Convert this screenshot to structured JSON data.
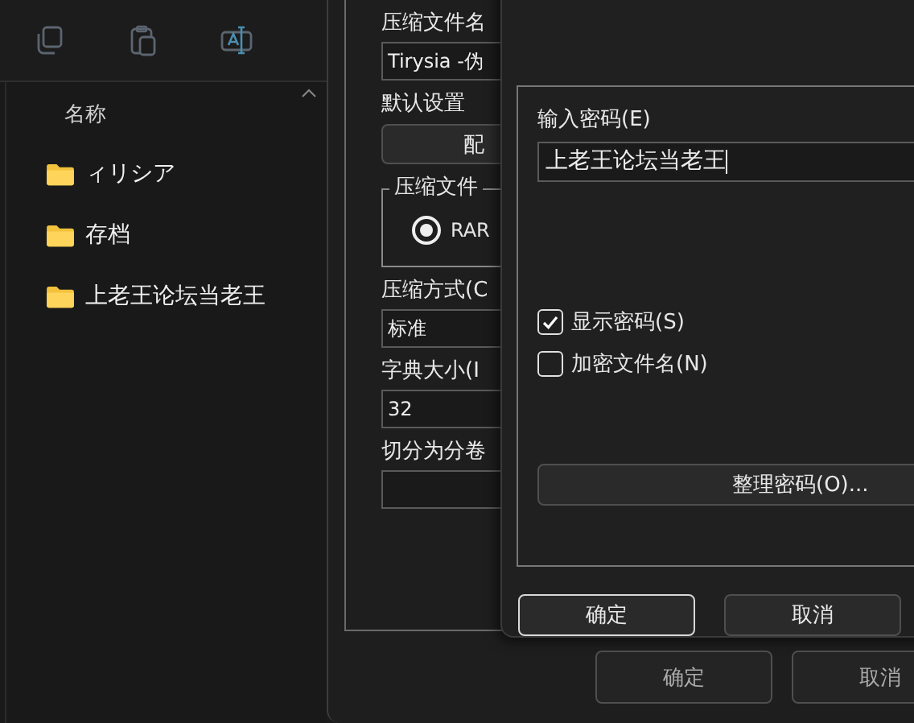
{
  "explorer": {
    "column_header": "名称",
    "folders": [
      {
        "name": "ィリシア"
      },
      {
        "name": "存档"
      },
      {
        "name": "上老王论坛当老王"
      }
    ]
  },
  "archive_dialog": {
    "archive_name_label": "压缩文件名",
    "archive_name_value": "Tirysia -伪",
    "default_settings_label": "默认设置",
    "profiles_button": "配",
    "format_group_label": "压缩文件",
    "formats": [
      {
        "label": "RAR",
        "selected": true
      }
    ],
    "method_label": "压缩方式(C",
    "method_value": "标准",
    "dictionary_label": "字典大小(I",
    "dictionary_value": "32",
    "split_label": "切分为分卷",
    "buttons": [
      {
        "label": "确定"
      },
      {
        "label": "取消"
      }
    ]
  },
  "password_dialog": {
    "password_label": "输入密码(E)",
    "password_value": "上老王论坛当老王",
    "options": [
      {
        "label": "显示密码(S)",
        "checked": true
      },
      {
        "label": "加密文件名(N)",
        "checked": false
      }
    ],
    "organize_button": "整理密码(O)...",
    "buttons": [
      {
        "label": "确定",
        "default": true
      },
      {
        "label": "取消",
        "default": false
      }
    ]
  }
}
